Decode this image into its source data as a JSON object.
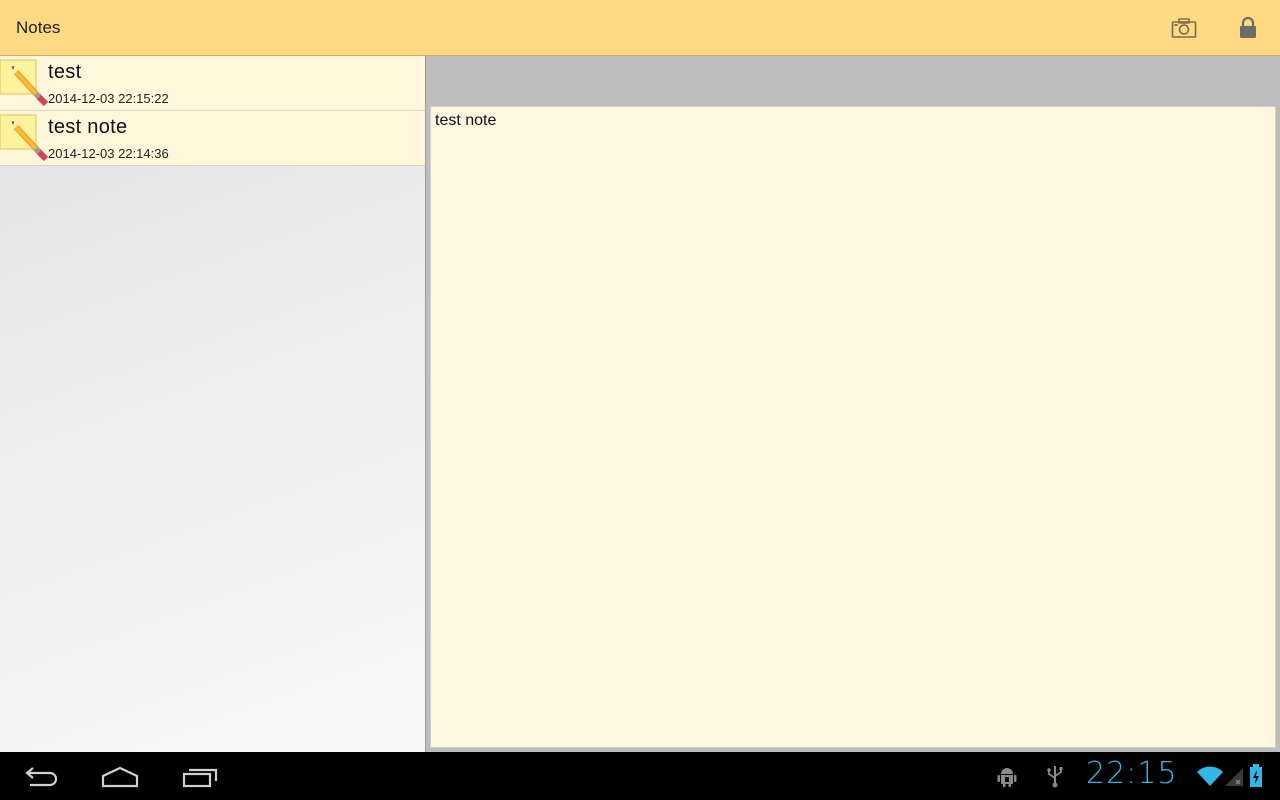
{
  "action_bar": {
    "title": "Notes",
    "background_color": "#ffda84",
    "actions": [
      {
        "icon": "camera-icon"
      },
      {
        "icon": "lock-icon"
      }
    ]
  },
  "notes": [
    {
      "title": "test",
      "date": "2014-12-03 22:15:22",
      "icon": "note-pencil-icon"
    },
    {
      "title": "test note",
      "date": "2014-12-03 22:14:36",
      "icon": "note-pencil-icon"
    }
  ],
  "editor": {
    "content": "test note",
    "background_color": "#fff6df"
  },
  "system_bar": {
    "clock": "22:15",
    "clock_color": "#33b5e5",
    "nav": [
      "back-icon",
      "home-icon",
      "recent-apps-icon"
    ],
    "status_icons": [
      "android-debug-icon",
      "usb-icon",
      "wifi-icon",
      "signal-icon",
      "battery-icon"
    ]
  }
}
